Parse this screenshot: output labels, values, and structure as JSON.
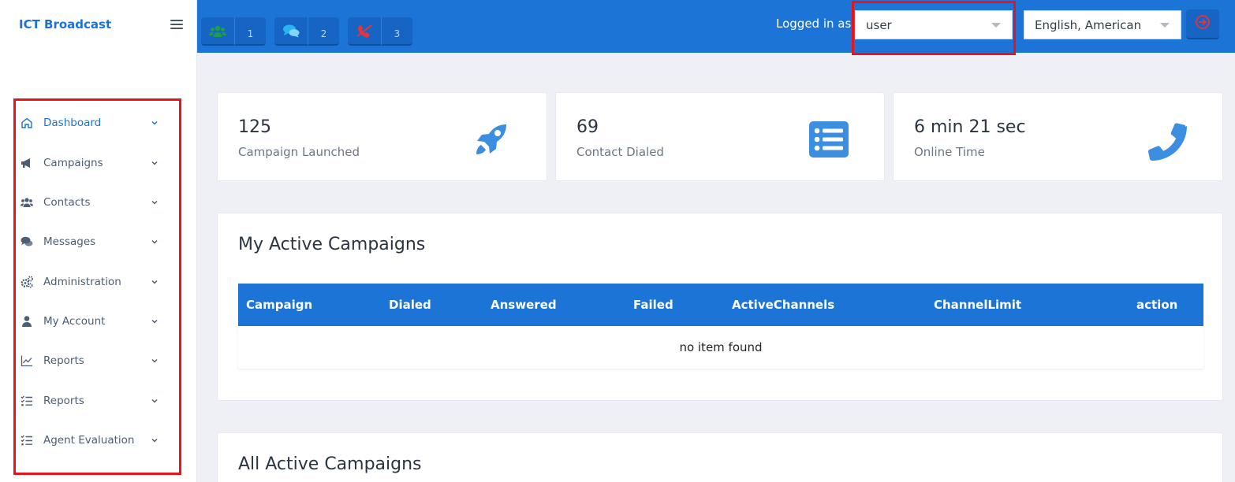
{
  "app": {
    "brand": "ICT Broadcast"
  },
  "sidebar": {
    "items": [
      {
        "label": "Dashboard",
        "icon": "home-icon"
      },
      {
        "label": "Campaigns",
        "icon": "megaphone-icon"
      },
      {
        "label": "Contacts",
        "icon": "users-icon"
      },
      {
        "label": "Messages",
        "icon": "chat-icon"
      },
      {
        "label": "Administration",
        "icon": "gears-icon"
      },
      {
        "label": "My Account",
        "icon": "user-icon"
      },
      {
        "label": "Reports",
        "icon": "chart-line-icon"
      },
      {
        "label": "Reports",
        "icon": "checklist-icon"
      },
      {
        "label": "Agent Evaluation",
        "icon": "checklist-icon"
      }
    ]
  },
  "topbar": {
    "buttons": [
      {
        "icon": "users-icon",
        "count": "1"
      },
      {
        "icon": "chat-icon",
        "count": "2"
      },
      {
        "icon": "phone-slash-icon",
        "count": "3"
      }
    ],
    "logged_in_label": "Logged in as :",
    "user_select": "user",
    "language_select": "English, American"
  },
  "stats": [
    {
      "value": "125",
      "label": "Campaign Launched",
      "icon": "rocket-icon"
    },
    {
      "value": "69",
      "label": "Contact Dialed",
      "icon": "list-icon"
    },
    {
      "value": "6 min 21 sec",
      "label": "Online Time",
      "icon": "phone-icon"
    }
  ],
  "active_campaigns": {
    "title": "My Active Campaigns",
    "columns": [
      "Campaign",
      "Dialed",
      "Answered",
      "Failed",
      "ActiveChannels",
      "ChannelLimit",
      "action"
    ],
    "empty_text": "no item found"
  },
  "all_campaigns": {
    "title": "All Active Campaigns"
  },
  "colors": {
    "primary": "#1c74d6",
    "highlight_border": "#e8141c"
  }
}
